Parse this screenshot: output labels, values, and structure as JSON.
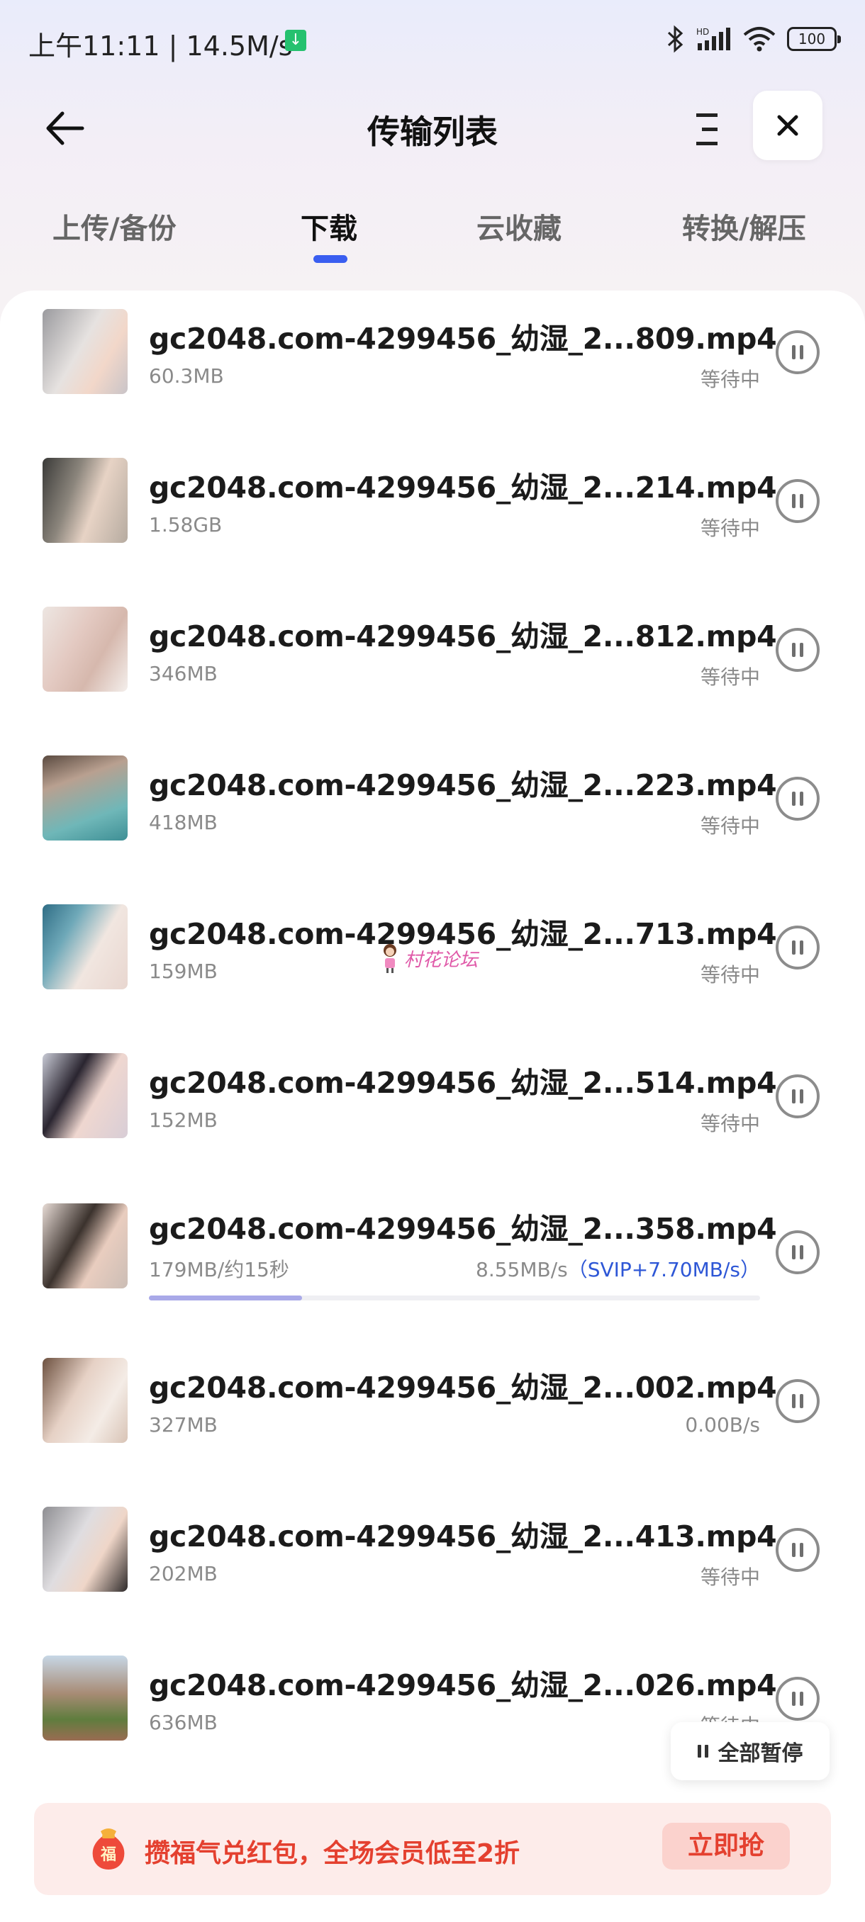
{
  "status_bar": {
    "time_speed": "上午11:11 | 14.5M/s",
    "battery": "100",
    "network": "HD"
  },
  "header": {
    "title": "传输列表"
  },
  "tabs": [
    {
      "label": "上传/备份",
      "active": false
    },
    {
      "label": "下载",
      "active": true
    },
    {
      "label": "云收藏",
      "active": false
    },
    {
      "label": "转换/解压",
      "active": false
    }
  ],
  "downloads": [
    {
      "name": "gc2048.com-4299456_幼湿_2...809.mp4",
      "size": "60.3MB",
      "status": "等待中"
    },
    {
      "name": "gc2048.com-4299456_幼湿_2...214.mp4",
      "size": "1.58GB",
      "status": "等待中"
    },
    {
      "name": "gc2048.com-4299456_幼湿_2...812.mp4",
      "size": "346MB",
      "status": "等待中"
    },
    {
      "name": "gc2048.com-4299456_幼湿_2...223.mp4",
      "size": "418MB",
      "status": "等待中"
    },
    {
      "name": "gc2048.com-4299456_幼湿_2...713.mp4",
      "size": "159MB",
      "status": "等待中"
    },
    {
      "name": "gc2048.com-4299456_幼湿_2...514.mp4",
      "size": "152MB",
      "status": "等待中"
    },
    {
      "name": "gc2048.com-4299456_幼湿_2...358.mp4",
      "size": "179MB/约15秒",
      "speed": "8.55MB/s",
      "svip_speed": "（SVIP+7.70MB/s）",
      "progress": 0.25
    },
    {
      "name": "gc2048.com-4299456_幼湿_2...002.mp4",
      "size": "327MB",
      "status": "0.00B/s"
    },
    {
      "name": "gc2048.com-4299456_幼湿_2...413.mp4",
      "size": "202MB",
      "status": "等待中"
    },
    {
      "name": "gc2048.com-4299456_幼湿_2...026.mp4",
      "size": "636MB",
      "status": "等待中"
    }
  ],
  "watermark": "村花论坛",
  "pause_all": {
    "label": "全部暂停"
  },
  "promo": {
    "badge": "福",
    "text": "攒福气兑红包，全场会员低至2折",
    "button": "立即抢"
  },
  "colors": {
    "accent": "#3a5ef0",
    "promo_red": "#e4402f",
    "svip_blue": "#2e57d6"
  }
}
